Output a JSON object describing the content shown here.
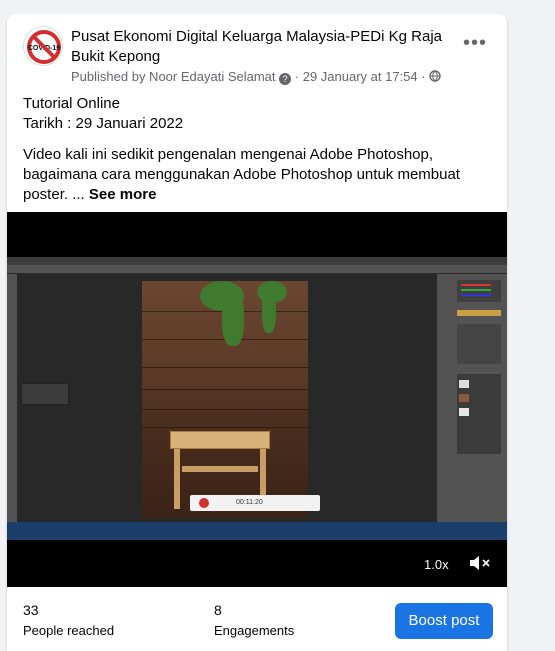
{
  "post": {
    "page_name": "Pusat Ekonomi Digital Keluarga Malaysia-PEDi Kg Raja Bukit Kepong",
    "avatar_text": "COVID-19",
    "published_by": "Published by Noor Edayati Selamat",
    "date": "29 January at 17:54",
    "more_icon": "more-options-icon",
    "line1": "Tutorial Online",
    "line2": "Tarikh : 29 Januari 2022",
    "description": "Video kali ini sedikit pengenalan mengenai Adobe Photoshop, bagaimana cara menggunakan Adobe Photoshop untuk membuat poster. ...",
    "see_more": "See more"
  },
  "video": {
    "recorder_time": "00:11:20",
    "playback_speed": "1.0x",
    "volume_icon": "muted-speaker-icon"
  },
  "stats": {
    "reached_count": "33",
    "reached_label": "People reached",
    "engagements_count": "8",
    "engagements_label": "Engagements",
    "boost_label": "Boost post"
  },
  "colors": {
    "accent": "#1b74e4",
    "secondary_text": "#65676b",
    "avatar_ring": "#d32f2f"
  }
}
